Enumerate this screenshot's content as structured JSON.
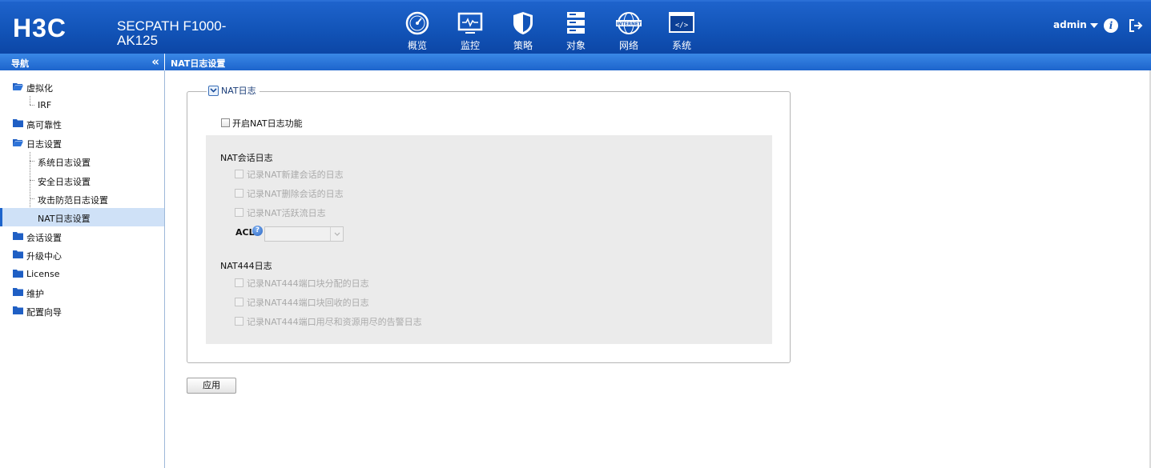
{
  "header": {
    "logo_text": "H3C",
    "product_line1": "SECPATH F1000-",
    "product_line2": "AK125",
    "nav": [
      {
        "label": "概览",
        "icon": "gauge-icon"
      },
      {
        "label": "监控",
        "icon": "monitor-icon"
      },
      {
        "label": "策略",
        "icon": "shield-icon"
      },
      {
        "label": "对象",
        "icon": "server-stack-icon"
      },
      {
        "label": "网络",
        "icon": "globe-internet-icon",
        "icon_text": "INTERNET"
      },
      {
        "label": "系统",
        "icon": "code-window-icon",
        "active": true
      }
    ],
    "user": "admin",
    "info_icon_text": "i"
  },
  "sidebar": {
    "title": "导航",
    "collapse_icon": "«",
    "items": [
      {
        "label": "虚拟化",
        "type": "folder-open"
      },
      {
        "label": "IRF",
        "type": "child"
      },
      {
        "label": "高可靠性",
        "type": "folder"
      },
      {
        "label": "日志设置",
        "type": "folder-open"
      },
      {
        "label": "系统日志设置",
        "type": "child"
      },
      {
        "label": "安全日志设置",
        "type": "child"
      },
      {
        "label": "攻击防范日志设置",
        "type": "child"
      },
      {
        "label": "NAT日志设置",
        "type": "child",
        "selected": true
      },
      {
        "label": "会话设置",
        "type": "folder"
      },
      {
        "label": "升级中心",
        "type": "folder"
      },
      {
        "label": "License",
        "type": "folder"
      },
      {
        "label": "维护",
        "type": "folder"
      },
      {
        "label": "配置向导",
        "type": "folder"
      }
    ]
  },
  "page": {
    "title": "NAT日志设置",
    "fieldset_legend": "NAT日志",
    "enable_label": "开启NAT日志功能",
    "session_section": {
      "title": "NAT会话日志",
      "options": [
        "记录NAT新建会话的日志",
        "记录NAT删除会话的日志",
        "记录NAT活跃流日志"
      ],
      "acl_label": "ACL",
      "acl_help": "?",
      "acl_value": ""
    },
    "nat444_section": {
      "title": "NAT444日志",
      "options": [
        "记录NAT444端口块分配的日志",
        "记录NAT444端口块回收的日志",
        "记录NAT444端口用尽和资源用尽的告警日志"
      ]
    },
    "apply_label": "应用"
  },
  "colors": {
    "header_blue": "#1254b8",
    "bar_blue": "#1d64cc",
    "selected_bg": "#cfe1f7",
    "panel_gray": "#ebebeb",
    "disabled_text": "#aaaaaa"
  }
}
